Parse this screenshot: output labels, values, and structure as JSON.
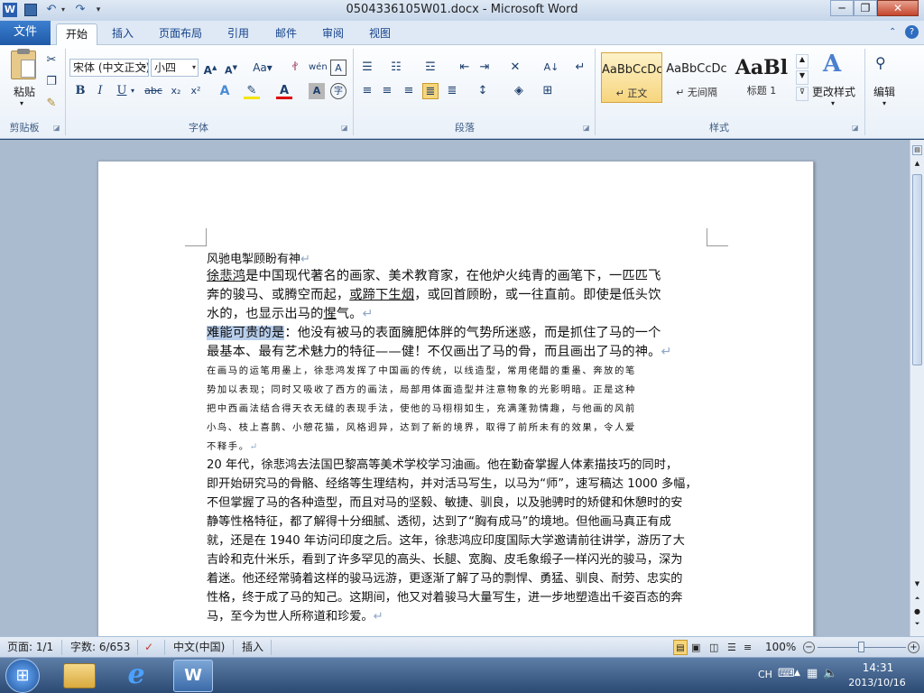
{
  "window": {
    "title": "0504336105W01.docx - Microsoft Word",
    "app_icon": "W",
    "controls": {
      "minimize": "─",
      "restore": "❐",
      "close": "✕"
    }
  },
  "quick_access": {
    "save": "save-icon",
    "undo": "↶",
    "redo": "↷"
  },
  "tabs": {
    "file": "文件",
    "items": [
      "开始",
      "插入",
      "页面布局",
      "引用",
      "邮件",
      "审阅",
      "视图"
    ],
    "active": "开始"
  },
  "ribbon": {
    "clipboard": {
      "paste": "粘贴",
      "label": "剪贴板"
    },
    "font": {
      "name": "宋体 (中文正文)",
      "size": "小四",
      "label": "字体",
      "row1": [
        "A▲",
        "A▼",
        "Aa",
        "wén",
        "A",
        "A"
      ],
      "row2": {
        "bold": "B",
        "italic": "I",
        "underline": "U",
        "strike": "abc",
        "sub": "x₂",
        "sup": "x²"
      }
    },
    "paragraph": {
      "label": "段落"
    },
    "styles": {
      "label": "样式",
      "items": [
        {
          "sample": "AaBbCcDc",
          "name": "↵ 正文"
        },
        {
          "sample": "AaBbCcDc",
          "name": "↵ 无间隔"
        },
        {
          "sample": "AaBl",
          "name": "标题 1"
        }
      ],
      "change": "更改样式"
    },
    "editing": {
      "label": "编辑"
    }
  },
  "document": {
    "title_line": "风驰电掣顾盼有神",
    "p1_l1_a": "徐悲鸿",
    "p1_l1_b": "是中国现代著名的画家、美术教育家，在他炉火纯青的画笔下，一匹匹飞",
    "p1_l2_a": "奔的骏马、或腾空而起，",
    "p1_l2_b": "或蹄下生烟",
    "p1_l2_c": "，或回首顾盼，或一往直前。即使是低头饮",
    "p1_l3": "水的，也显示出马的",
    "p1_l3_ul": "惺",
    "p1_l3_end": "气。",
    "p2_l1_sel": "难能可贵的是",
    "p2_l1_rest": "：他没有被马的表面臃肥体胖的气势所迷惑，而是抓住了马的一个",
    "p2_l2": "最基本、最有艺术魅力的特征——健！不仅画出了马的骨，而且画出了马的神。",
    "p3_lines": [
      "在画马的运笔用墨上，徐悲鸿发挥了中国画的传统，以线造型，常用佬醋的重墨、奔放的笔",
      "势加以表现；同时又吸收了西方的画法，局部用体面造型并注意物象的光影明暗。正是这种",
      "把中西画法结合得天衣无缝的表现手法，使他的马栩栩如生，充满蓬勃情趣，与他画的风前",
      "小鸟、枝上喜鹊、小憩花猫，风格迥异，达到了新的境界，取得了前所未有的效果，令人爱",
      "不释手。"
    ],
    "p4_lines": [
      "20 年代，徐悲鸿去法国巴黎高等美术学校学习油画。他在勤奋掌握人体素描技巧的同时，",
      "即开始研究马的骨骼、经络等生理结构，并对活马写生，以马为“师”，速写稿达 1000 多幅，",
      "不但掌握了马的各种造型，而且对马的坚毅、敏捷、驯良，以及驰骋时的矫健和休憩时的安",
      "静等性格特征，都了解得十分细腻、透彻，达到了“胸有成马”的境地。但他画马真正有成",
      "就，还是在 1940 年访问印度之后。这年，徐悲鸿应印度国际大学邀请前往讲学，游历了大",
      "吉岭和克什米乐，看到了许多罕见的高头、长腿、宽胸、皮毛象缎子一样闪光的骏马，深为",
      "着迷。他还经常骑着这样的骏马远游，更逐渐了解了马的剽悍、勇猛、驯良、耐劳、忠实的",
      "性格，终于成了马的知己。这期间，他又对着骏马大量写生，进一步地塑造出千姿百态的奔",
      "马，至今为世人所称道和珍爱。"
    ],
    "para_mark": "↵"
  },
  "status": {
    "page": "页面: 1/1",
    "words": "字数: 6/653",
    "lang": "中文(中国)",
    "mode": "插入",
    "zoom": "100%"
  },
  "taskbar": {
    "time": "14:31",
    "date": "2013/10/16",
    "lang": "CH"
  },
  "colors": {
    "accent": "#1f5aa8",
    "selection": "#b7cdeb",
    "taskbar": "#2b4a73"
  }
}
